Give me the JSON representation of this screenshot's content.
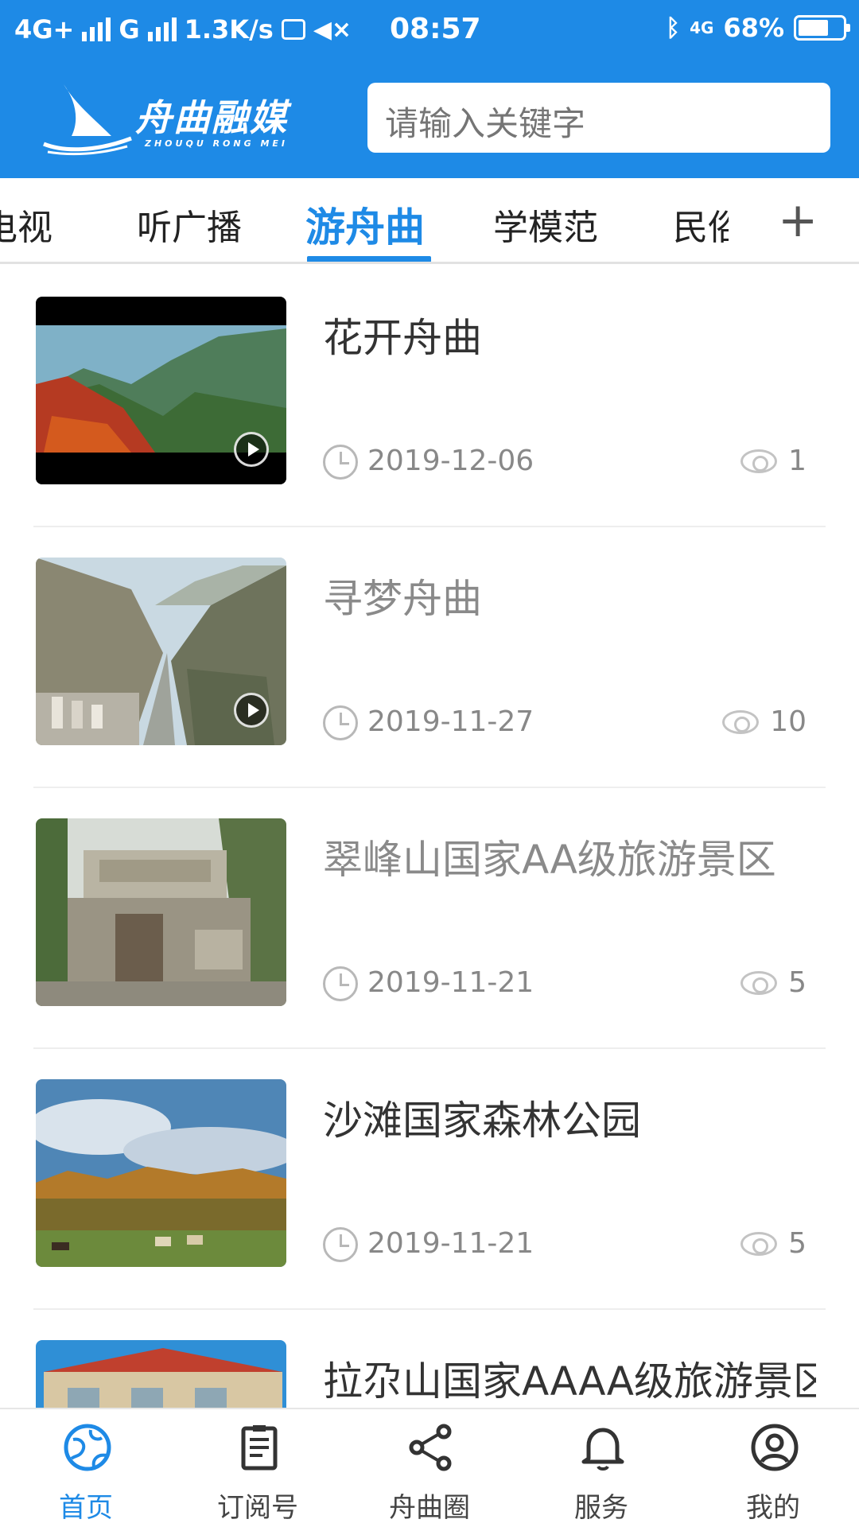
{
  "status_bar": {
    "network1": "4G+",
    "network2": "G",
    "speed": "1.3K/s",
    "time": "08:57",
    "network3": "4G",
    "battery": "68%",
    "battery_level": 0.68
  },
  "header": {
    "logo_text": "舟曲融媒",
    "logo_subtext": "ZHOUQU RONG MEI",
    "search_placeholder": "请输入关键字"
  },
  "tabs": [
    {
      "label": "电视"
    },
    {
      "label": "听广播"
    },
    {
      "label": "游舟曲"
    },
    {
      "label": "学模范"
    },
    {
      "label": "民俗"
    }
  ],
  "tab_add": "+",
  "items": [
    {
      "title": "花开舟曲",
      "date": "2019-12-06",
      "views": "1"
    },
    {
      "title": "寻梦舟曲",
      "date": "2019-11-27",
      "views": "10"
    },
    {
      "title": "翠峰山国家AA级旅游景区",
      "date": "2019-11-21",
      "views": "5"
    },
    {
      "title": "沙滩国家森林公园",
      "date": "2019-11-21",
      "views": "5"
    },
    {
      "title": "拉尕山国家AAAA级旅游景区",
      "date": "",
      "views": ""
    }
  ],
  "nav": [
    {
      "label": "首页",
      "icon": "globe-icon"
    },
    {
      "label": "订阅号",
      "icon": "document-icon"
    },
    {
      "label": "舟曲圈",
      "icon": "share-icon"
    },
    {
      "label": "服务",
      "icon": "bell-icon"
    },
    {
      "label": "我的",
      "icon": "user-icon"
    }
  ],
  "colors": {
    "brand": "#1e8ae6",
    "text": "#333333",
    "muted": "#888888"
  }
}
